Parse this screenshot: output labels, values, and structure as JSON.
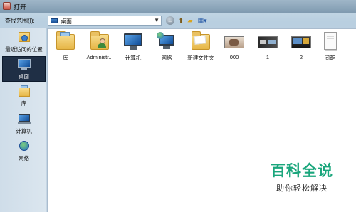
{
  "window": {
    "title": "打开"
  },
  "toolbar": {
    "lookin_label": "查找范围(I):",
    "lookin_value": "桌面",
    "back_icon": "back-arrow-icon",
    "up_icon": "up-folder-icon",
    "newfolder_icon": "new-folder-icon",
    "view_icon": "view-menu-icon"
  },
  "places": [
    {
      "label": "最近访问的位置",
      "icon": "recent-places-icon"
    },
    {
      "label": "桌面",
      "icon": "desktop-icon",
      "selected": true
    },
    {
      "label": "库",
      "icon": "library-icon"
    },
    {
      "label": "计算机",
      "icon": "computer-icon"
    },
    {
      "label": "网络",
      "icon": "network-icon"
    }
  ],
  "items": [
    {
      "label": "库",
      "icon": "library-folder-icon"
    },
    {
      "label": "Administr...",
      "icon": "user-folder-icon"
    },
    {
      "label": "计算机",
      "icon": "computer-icon"
    },
    {
      "label": "网络",
      "icon": "network-icon"
    },
    {
      "label": "新建文件夹",
      "icon": "folder-icon"
    },
    {
      "label": "000",
      "icon": "image-thumbnail-icon"
    },
    {
      "label": "1",
      "icon": "image-thumbnail-icon"
    },
    {
      "label": "2",
      "icon": "image-thumbnail-icon"
    },
    {
      "label": "间距",
      "icon": "document-icon"
    }
  ],
  "watermark": {
    "title": "百科全说",
    "subtitle": "助你轻松解决"
  },
  "colors": {
    "accent": "#1aa67c",
    "selection": "#1f2f45"
  }
}
